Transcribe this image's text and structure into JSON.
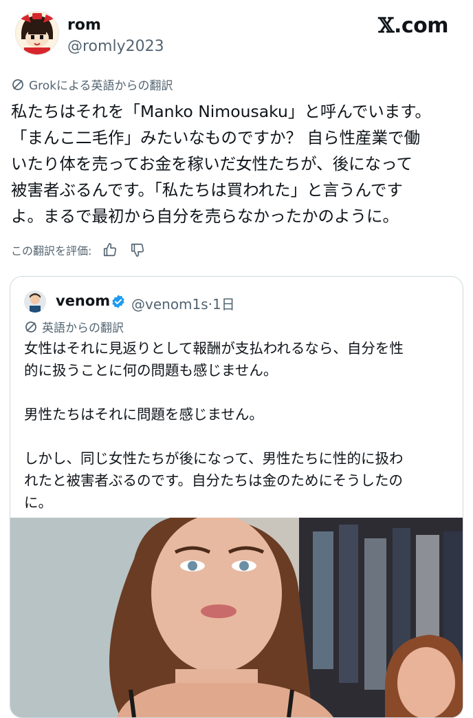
{
  "author": {
    "display_name": "rom",
    "handle": "@romly2023"
  },
  "brand": {
    "x": "𝕏",
    "domain": ".com"
  },
  "post": {
    "translation_note": "Grokによる英語からの翻訳",
    "text": "私たちはそれを「Manko Nimousaku」と呼んでいます。\n「まんこ二毛作」みたいなものですか？ 自ら性産業で働\nいたり体を売ってお金を稼いだ女性たちが、後になって\n被害者ぶるんです。「私たちは買われた」と言うんです\nよ。まるで最初から自分を売らなかったかのように。",
    "rate_label": "この翻訳を評価:"
  },
  "quoted": {
    "display_name": "venom",
    "handle_time": "@venom1s·1日",
    "translation_note": "英語からの翻訳",
    "text": "女性はそれに見返りとして報酬が支払われるなら、自分を性\n的に扱うことに何の問題も感じません。\n\n男性たちはそれに問題を感じません。\n\nしかし、同じ女性たちが後になって、男性たちに性的に扱わ\nれたと被害者ぶるのです。自分たちは金のためにそうしたの\nに。"
  },
  "icons": {
    "translate": "translate-icon",
    "thumb_up": "thumbs-up-icon",
    "thumb_down": "thumbs-down-icon",
    "verified": "verified-badge-icon"
  },
  "colors": {
    "text": "#0f1419",
    "muted": "#536471",
    "verified_blue": "#1d9bf0",
    "border": "#cfd9de"
  }
}
